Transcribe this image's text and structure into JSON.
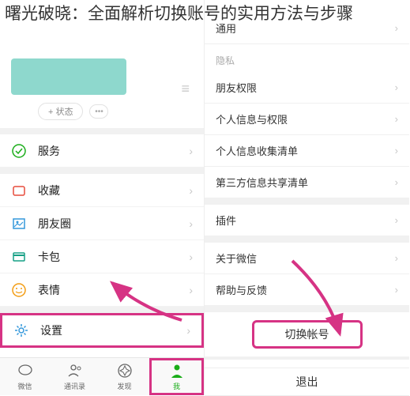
{
  "title": "曙光破晓：全面解析切换账号的实用方法与步骤",
  "left": {
    "status_label": "+ 状态",
    "rows": [
      {
        "icon": "service",
        "label": "服务"
      },
      {
        "icon": "fav",
        "label": "收藏"
      },
      {
        "icon": "moments",
        "label": "朋友圈"
      },
      {
        "icon": "card",
        "label": "卡包"
      },
      {
        "icon": "sticker",
        "label": "表情"
      },
      {
        "icon": "settings",
        "label": "设置"
      }
    ],
    "tabs": [
      {
        "label": "微信"
      },
      {
        "label": "通讯录"
      },
      {
        "label": "发现"
      },
      {
        "label": "我"
      }
    ]
  },
  "right": {
    "section_general": "通用",
    "section_privacy": "隐私",
    "rows_privacy": [
      "朋友权限",
      "个人信息与权限",
      "个人信息收集清单",
      "第三方信息共享清单"
    ],
    "rows_other": [
      "插件",
      "关于微信",
      "帮助与反馈"
    ],
    "switch_account": "切换帐号",
    "logout": "退出"
  }
}
